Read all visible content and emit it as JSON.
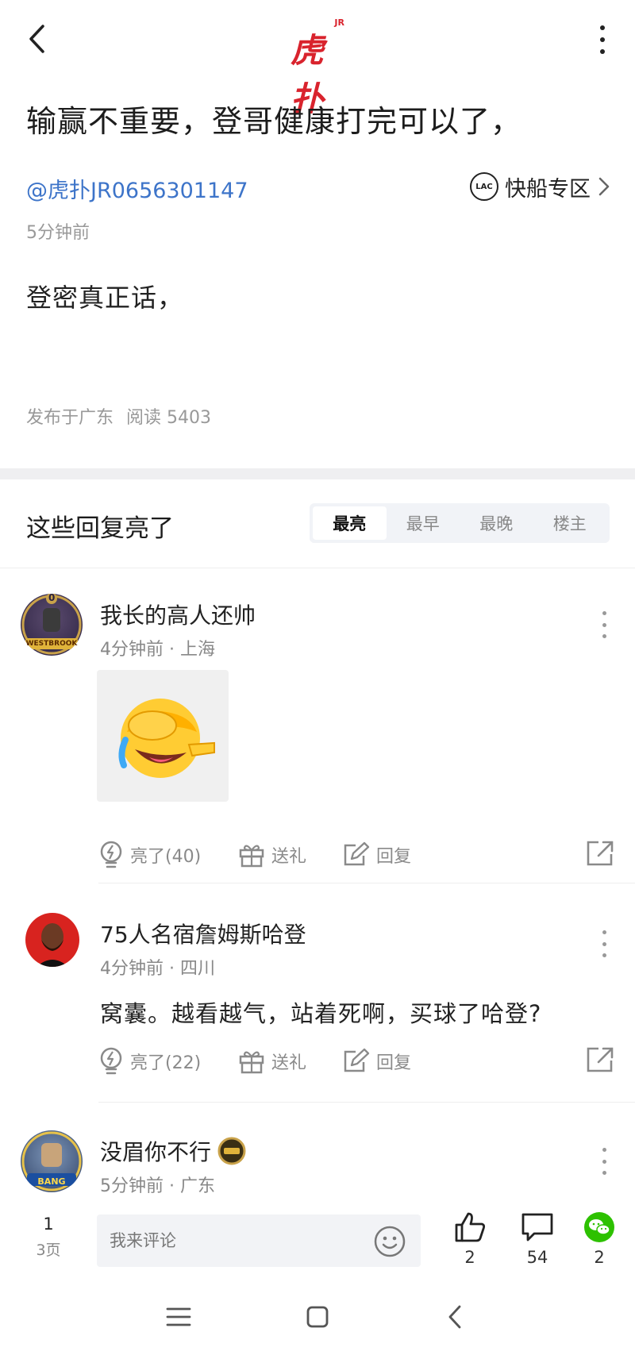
{
  "header": {
    "logo_text": "虎扑",
    "logo_sup": "JR"
  },
  "post": {
    "title": "输赢不重要，登哥健康打完可以了，",
    "author": "@虎扑JR0656301147",
    "forum": {
      "name": "快船专区",
      "logo_text": "LAC"
    },
    "time": "5分钟前",
    "body": "登密真正话，",
    "location": "发布于广东",
    "reads": "阅读 5403"
  },
  "replies_section": {
    "title": "这些回复亮了",
    "sort_tabs": [
      "最亮",
      "最早",
      "最晚",
      "楼主"
    ],
    "active_tab": 0
  },
  "replies": [
    {
      "name": "我长的高人还帅",
      "avatar_label": "WESTBROOK",
      "avatar_number": "0",
      "meta": "4分钟前 · 上海",
      "text": "",
      "has_image": true,
      "actions": {
        "light": "亮了(40)",
        "gift": "送礼",
        "reply": "回复"
      }
    },
    {
      "name": "75人名宿詹姆斯哈登",
      "avatar_label": "",
      "meta": "4分钟前 · 四川",
      "text": "窝囊。越看越气，站着死啊，买球了哈登?",
      "has_image": false,
      "actions": {
        "light": "亮了(22)",
        "gift": "送礼",
        "reply": "回复"
      }
    },
    {
      "name": "没眉你不行",
      "avatar_label": "BANG",
      "meta": "5分钟前 · 广东",
      "text": "",
      "has_image": false
    }
  ],
  "bottombar": {
    "page_current": "1",
    "page_total": "3页",
    "comment_placeholder": "我来评论",
    "likes": "2",
    "comments": "54",
    "wechat_shares": "2"
  },
  "colors": {
    "brand": "#d9232d",
    "link": "#3d74c9",
    "wechat": "#2dc100"
  }
}
